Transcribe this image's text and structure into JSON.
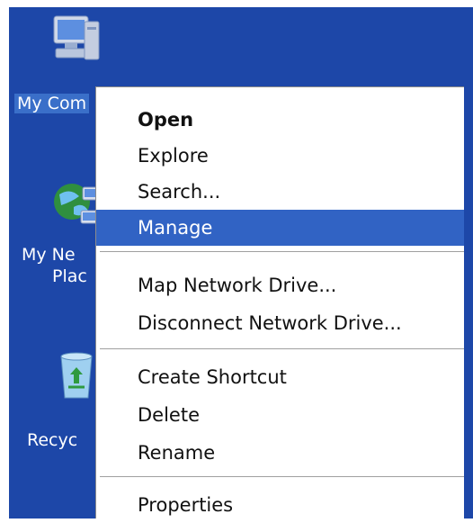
{
  "desktop": {
    "icons": [
      {
        "label": "My Com"
      },
      {
        "label_line1": "My Ne",
        "label_line2": "Plac"
      },
      {
        "label": "Recyc"
      }
    ]
  },
  "context_menu": {
    "items": [
      {
        "label": "Open",
        "bold": true
      },
      {
        "label": "Explore"
      },
      {
        "label": "Search..."
      },
      {
        "label": "Manage",
        "highlighted": true
      },
      {
        "label": "Map Network Drive..."
      },
      {
        "label": "Disconnect Network Drive..."
      },
      {
        "label": "Create Shortcut"
      },
      {
        "label": "Delete"
      },
      {
        "label": "Rename"
      },
      {
        "label": "Properties"
      }
    ]
  },
  "colors": {
    "desktop_bg": "#1d47a8",
    "highlight": "#3163c4",
    "menu_bg": "#ffffff"
  }
}
